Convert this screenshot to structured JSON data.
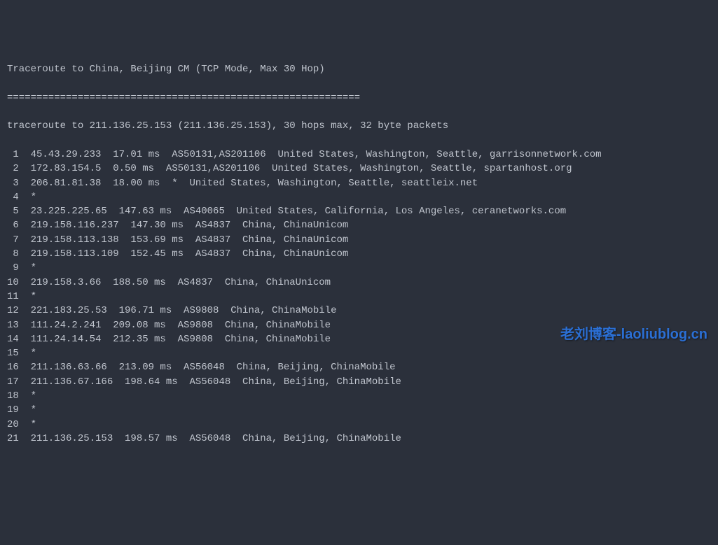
{
  "header": {
    "title": "Traceroute to China, Beijing CM (TCP Mode, Max 30 Hop)",
    "separator": "============================================================"
  },
  "summary": "traceroute to 211.136.25.153 (211.136.25.153), 30 hops max, 32 byte packets",
  "hops": [
    {
      "num": " 1",
      "ip": "45.43.29.233",
      "latency": "17.01 ms",
      "asn": "AS50131,AS201106",
      "location": "United States, Washington, Seattle, garrisonnetwork.com"
    },
    {
      "num": " 2",
      "ip": "172.83.154.5",
      "latency": "0.50 ms",
      "asn": "AS50131,AS201106",
      "location": "United States, Washington, Seattle, spartanhost.org"
    },
    {
      "num": " 3",
      "ip": "206.81.81.38",
      "latency": "18.00 ms",
      "asn": "*",
      "location": "United States, Washington, Seattle, seattleix.net"
    },
    {
      "num": " 4",
      "ip": "*",
      "latency": "",
      "asn": "",
      "location": ""
    },
    {
      "num": " 5",
      "ip": "23.225.225.65",
      "latency": "147.63 ms",
      "asn": "AS40065",
      "location": "United States, California, Los Angeles, ceranetworks.com"
    },
    {
      "num": " 6",
      "ip": "219.158.116.237",
      "latency": "147.30 ms",
      "asn": "AS4837",
      "location": "China, ChinaUnicom"
    },
    {
      "num": " 7",
      "ip": "219.158.113.138",
      "latency": "153.69 ms",
      "asn": "AS4837",
      "location": "China, ChinaUnicom"
    },
    {
      "num": " 8",
      "ip": "219.158.113.109",
      "latency": "152.45 ms",
      "asn": "AS4837",
      "location": "China, ChinaUnicom"
    },
    {
      "num": " 9",
      "ip": "*",
      "latency": "",
      "asn": "",
      "location": ""
    },
    {
      "num": "10",
      "ip": "219.158.3.66",
      "latency": "188.50 ms",
      "asn": "AS4837",
      "location": "China, ChinaUnicom"
    },
    {
      "num": "11",
      "ip": "*",
      "latency": "",
      "asn": "",
      "location": ""
    },
    {
      "num": "12",
      "ip": "221.183.25.53",
      "latency": "196.71 ms",
      "asn": "AS9808",
      "location": "China, ChinaMobile"
    },
    {
      "num": "13",
      "ip": "111.24.2.241",
      "latency": "209.08 ms",
      "asn": "AS9808",
      "location": "China, ChinaMobile"
    },
    {
      "num": "14",
      "ip": "111.24.14.54",
      "latency": "212.35 ms",
      "asn": "AS9808",
      "location": "China, ChinaMobile"
    },
    {
      "num": "15",
      "ip": "*",
      "latency": "",
      "asn": "",
      "location": ""
    },
    {
      "num": "16",
      "ip": "211.136.63.66",
      "latency": "213.09 ms",
      "asn": "AS56048",
      "location": "China, Beijing, ChinaMobile"
    },
    {
      "num": "17",
      "ip": "211.136.67.166",
      "latency": "198.64 ms",
      "asn": "AS56048",
      "location": "China, Beijing, ChinaMobile"
    },
    {
      "num": "18",
      "ip": "*",
      "latency": "",
      "asn": "",
      "location": ""
    },
    {
      "num": "19",
      "ip": "*",
      "latency": "",
      "asn": "",
      "location": ""
    },
    {
      "num": "20",
      "ip": "*",
      "latency": "",
      "asn": "",
      "location": ""
    },
    {
      "num": "21",
      "ip": "211.136.25.153",
      "latency": "198.57 ms",
      "asn": "AS56048",
      "location": "China, Beijing, ChinaMobile"
    }
  ],
  "watermark": {
    "cn": "老刘博客",
    "en": "-laoliublog.cn"
  }
}
